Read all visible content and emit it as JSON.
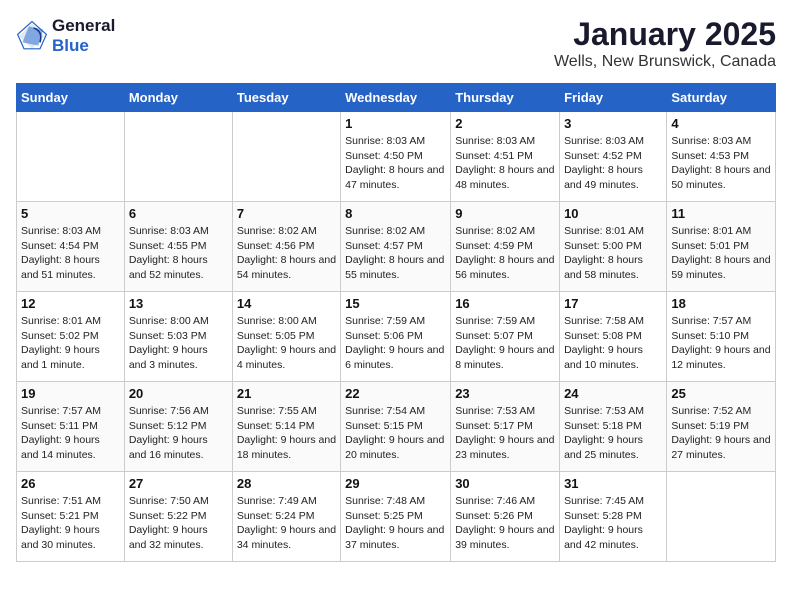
{
  "header": {
    "logo_line1": "General",
    "logo_line2": "Blue",
    "title": "January 2025",
    "subtitle": "Wells, New Brunswick, Canada"
  },
  "weekdays": [
    "Sunday",
    "Monday",
    "Tuesday",
    "Wednesday",
    "Thursday",
    "Friday",
    "Saturday"
  ],
  "weeks": [
    [
      {
        "day": "",
        "info": ""
      },
      {
        "day": "",
        "info": ""
      },
      {
        "day": "",
        "info": ""
      },
      {
        "day": "1",
        "info": "Sunrise: 8:03 AM\nSunset: 4:50 PM\nDaylight: 8 hours and 47 minutes."
      },
      {
        "day": "2",
        "info": "Sunrise: 8:03 AM\nSunset: 4:51 PM\nDaylight: 8 hours and 48 minutes."
      },
      {
        "day": "3",
        "info": "Sunrise: 8:03 AM\nSunset: 4:52 PM\nDaylight: 8 hours and 49 minutes."
      },
      {
        "day": "4",
        "info": "Sunrise: 8:03 AM\nSunset: 4:53 PM\nDaylight: 8 hours and 50 minutes."
      }
    ],
    [
      {
        "day": "5",
        "info": "Sunrise: 8:03 AM\nSunset: 4:54 PM\nDaylight: 8 hours and 51 minutes."
      },
      {
        "day": "6",
        "info": "Sunrise: 8:03 AM\nSunset: 4:55 PM\nDaylight: 8 hours and 52 minutes."
      },
      {
        "day": "7",
        "info": "Sunrise: 8:02 AM\nSunset: 4:56 PM\nDaylight: 8 hours and 54 minutes."
      },
      {
        "day": "8",
        "info": "Sunrise: 8:02 AM\nSunset: 4:57 PM\nDaylight: 8 hours and 55 minutes."
      },
      {
        "day": "9",
        "info": "Sunrise: 8:02 AM\nSunset: 4:59 PM\nDaylight: 8 hours and 56 minutes."
      },
      {
        "day": "10",
        "info": "Sunrise: 8:01 AM\nSunset: 5:00 PM\nDaylight: 8 hours and 58 minutes."
      },
      {
        "day": "11",
        "info": "Sunrise: 8:01 AM\nSunset: 5:01 PM\nDaylight: 8 hours and 59 minutes."
      }
    ],
    [
      {
        "day": "12",
        "info": "Sunrise: 8:01 AM\nSunset: 5:02 PM\nDaylight: 9 hours and 1 minute."
      },
      {
        "day": "13",
        "info": "Sunrise: 8:00 AM\nSunset: 5:03 PM\nDaylight: 9 hours and 3 minutes."
      },
      {
        "day": "14",
        "info": "Sunrise: 8:00 AM\nSunset: 5:05 PM\nDaylight: 9 hours and 4 minutes."
      },
      {
        "day": "15",
        "info": "Sunrise: 7:59 AM\nSunset: 5:06 PM\nDaylight: 9 hours and 6 minutes."
      },
      {
        "day": "16",
        "info": "Sunrise: 7:59 AM\nSunset: 5:07 PM\nDaylight: 9 hours and 8 minutes."
      },
      {
        "day": "17",
        "info": "Sunrise: 7:58 AM\nSunset: 5:08 PM\nDaylight: 9 hours and 10 minutes."
      },
      {
        "day": "18",
        "info": "Sunrise: 7:57 AM\nSunset: 5:10 PM\nDaylight: 9 hours and 12 minutes."
      }
    ],
    [
      {
        "day": "19",
        "info": "Sunrise: 7:57 AM\nSunset: 5:11 PM\nDaylight: 9 hours and 14 minutes."
      },
      {
        "day": "20",
        "info": "Sunrise: 7:56 AM\nSunset: 5:12 PM\nDaylight: 9 hours and 16 minutes."
      },
      {
        "day": "21",
        "info": "Sunrise: 7:55 AM\nSunset: 5:14 PM\nDaylight: 9 hours and 18 minutes."
      },
      {
        "day": "22",
        "info": "Sunrise: 7:54 AM\nSunset: 5:15 PM\nDaylight: 9 hours and 20 minutes."
      },
      {
        "day": "23",
        "info": "Sunrise: 7:53 AM\nSunset: 5:17 PM\nDaylight: 9 hours and 23 minutes."
      },
      {
        "day": "24",
        "info": "Sunrise: 7:53 AM\nSunset: 5:18 PM\nDaylight: 9 hours and 25 minutes."
      },
      {
        "day": "25",
        "info": "Sunrise: 7:52 AM\nSunset: 5:19 PM\nDaylight: 9 hours and 27 minutes."
      }
    ],
    [
      {
        "day": "26",
        "info": "Sunrise: 7:51 AM\nSunset: 5:21 PM\nDaylight: 9 hours and 30 minutes."
      },
      {
        "day": "27",
        "info": "Sunrise: 7:50 AM\nSunset: 5:22 PM\nDaylight: 9 hours and 32 minutes."
      },
      {
        "day": "28",
        "info": "Sunrise: 7:49 AM\nSunset: 5:24 PM\nDaylight: 9 hours and 34 minutes."
      },
      {
        "day": "29",
        "info": "Sunrise: 7:48 AM\nSunset: 5:25 PM\nDaylight: 9 hours and 37 minutes."
      },
      {
        "day": "30",
        "info": "Sunrise: 7:46 AM\nSunset: 5:26 PM\nDaylight: 9 hours and 39 minutes."
      },
      {
        "day": "31",
        "info": "Sunrise: 7:45 AM\nSunset: 5:28 PM\nDaylight: 9 hours and 42 minutes."
      },
      {
        "day": "",
        "info": ""
      }
    ]
  ]
}
